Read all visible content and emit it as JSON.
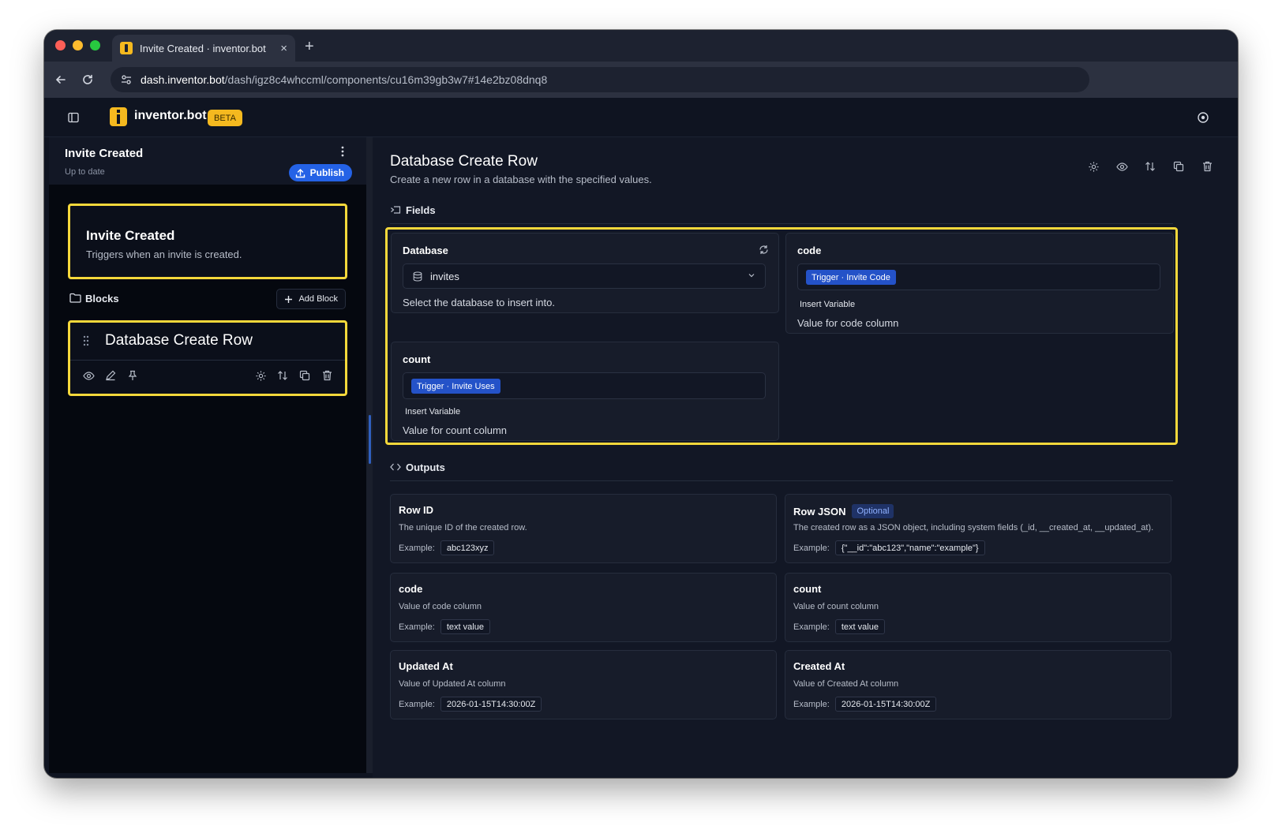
{
  "browser": {
    "tab_title": "Invite Created · inventor.bot",
    "new_tab": "+",
    "close": "×",
    "url_host": "dash.inventor.bot",
    "url_path": "/dash/igz8c4whccml/components/cu16m39gb3w7#14e2bz08dnq8"
  },
  "app": {
    "brand": "inventor.bot",
    "badge": "BETA",
    "accent": "#f5d83b",
    "primary": "#2462e6"
  },
  "sidebar": {
    "title": "Invite Created",
    "status": "Up to date",
    "publish_label": "Publish",
    "trigger": {
      "title": "Invite Created",
      "description": "Triggers when an invite is created."
    },
    "blocks_label": "Blocks",
    "add_block_label": "Add Block",
    "block": {
      "title": "Database Create Row",
      "left_actions": [
        "eye-icon",
        "pencil-icon",
        "pin-icon"
      ],
      "right_actions": [
        "gear-icon",
        "swap-icon",
        "copy-icon",
        "trash-icon"
      ]
    }
  },
  "main": {
    "title": "Database Create Row",
    "description": "Create a new row in a database with the specified values.",
    "actions": [
      "gear-icon",
      "eye-icon",
      "swap-icon",
      "copy-icon",
      "trash-icon"
    ],
    "fields_label": "Fields",
    "outputs_label": "Outputs",
    "fields": {
      "database": {
        "label": "Database",
        "value": "invites",
        "help": "Select the database to insert into."
      },
      "code": {
        "label": "code",
        "chip": "Trigger · Invite Code",
        "insert": "Insert Variable",
        "help": "Value for code column"
      },
      "count": {
        "label": "count",
        "chip": "Trigger · Invite Uses",
        "insert": "Insert Variable",
        "help": "Value for count column"
      }
    },
    "example_label": "Example:",
    "optional_label": "Optional",
    "outputs": [
      {
        "title": "Row ID",
        "description": "The unique ID of the created row.",
        "example": "abc123xyz"
      },
      {
        "title": "Row JSON",
        "description": "The created row as a JSON object, including system fields (_id, __created_at, __updated_at).",
        "example": "{\"__id\":\"abc123\",\"name\":\"example\"}"
      },
      {
        "title": "code",
        "description": "Value of code column",
        "example": "text value"
      },
      {
        "title": "count",
        "description": "Value of count column",
        "example": "text value"
      },
      {
        "title": "Updated At",
        "description": "Value of Updated At column",
        "example": "2026-01-15T14:30:00Z"
      },
      {
        "title": "Created At",
        "description": "Value of Created At column",
        "example": "2026-01-15T14:30:00Z"
      }
    ]
  }
}
